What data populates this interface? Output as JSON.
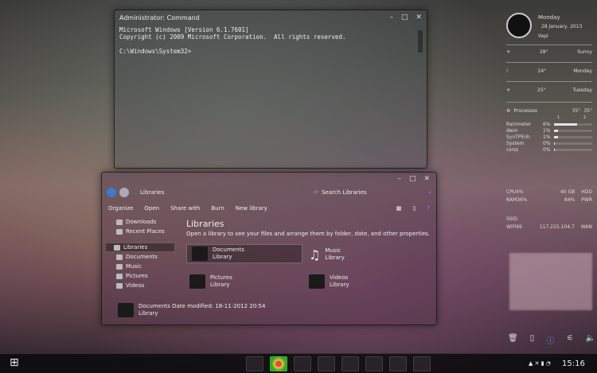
{
  "cmd": {
    "title": "Administrator: Command",
    "lines": [
      "Microsoft Windows [Version 6.1.7601]",
      "Copyright (c) 2009 Microsoft Corporation.  All rights reserved.",
      "",
      "C:\\Windows\\System32>"
    ],
    "controls": [
      "–",
      "□",
      "✕"
    ]
  },
  "explorer": {
    "breadcrumb": "Libraries",
    "search_placeholder": "Search Libraries",
    "commands": [
      "Organize",
      "Open",
      "Share with",
      "Burn",
      "New library"
    ],
    "sidebar": [
      "Downloads",
      "Recent Places",
      "Libraries",
      "Documents",
      "Music",
      "Pictures",
      "Videos"
    ],
    "heading": "Libraries",
    "subtitle": "Open a library to see your files and arrange them by folder, date, and other properties.",
    "libraries": [
      {
        "name": "Documents",
        "type": "Library"
      },
      {
        "name": "Music",
        "type": "Library"
      },
      {
        "name": "Pictures",
        "type": "Library"
      },
      {
        "name": "Videos",
        "type": "Library"
      }
    ],
    "details": {
      "name": "Documents",
      "modified": "Date modified: 18-11-2012 20:54",
      "type": "Library"
    }
  },
  "clock": {
    "day": "Monday",
    "date": "28 January, 2013",
    "city": "Vapi"
  },
  "weather": [
    {
      "temp": "28°",
      "label": "Sunny"
    },
    {
      "temp": "24°",
      "label": "Monday"
    },
    {
      "temp": "25°",
      "label": "Tuesday"
    }
  ],
  "processes": {
    "title": "Processes",
    "t1": "35°",
    "t2": "35°",
    "c1": "1",
    "c2": "2",
    "items": [
      {
        "name": "Rainmeter",
        "pct": "6%",
        "level": 0.6
      },
      {
        "name": "dwm",
        "pct": "1%",
        "level": 0.1
      },
      {
        "name": "SynTPEnh",
        "pct": "1%",
        "level": 0.1
      },
      {
        "name": "System",
        "pct": "0%",
        "level": 0.02
      },
      {
        "name": "csrss",
        "pct": "0%",
        "level": 0.02
      }
    ]
  },
  "stats": {
    "cpu_label": "CPU",
    "cpu": "4%",
    "hdd_val": "40 GB",
    "hdd_label": "HDD",
    "ram_label": "RAM",
    "ram": "36%",
    "pwr_val": "84%",
    "pwr_label": "PWR",
    "ssid_label": "SSID",
    "wifi_label": "WiFi",
    "wifi": "99",
    "ip": "117.215.104.7",
    "wan_label": "WAN"
  },
  "taskbar": {
    "time": "15:16"
  }
}
